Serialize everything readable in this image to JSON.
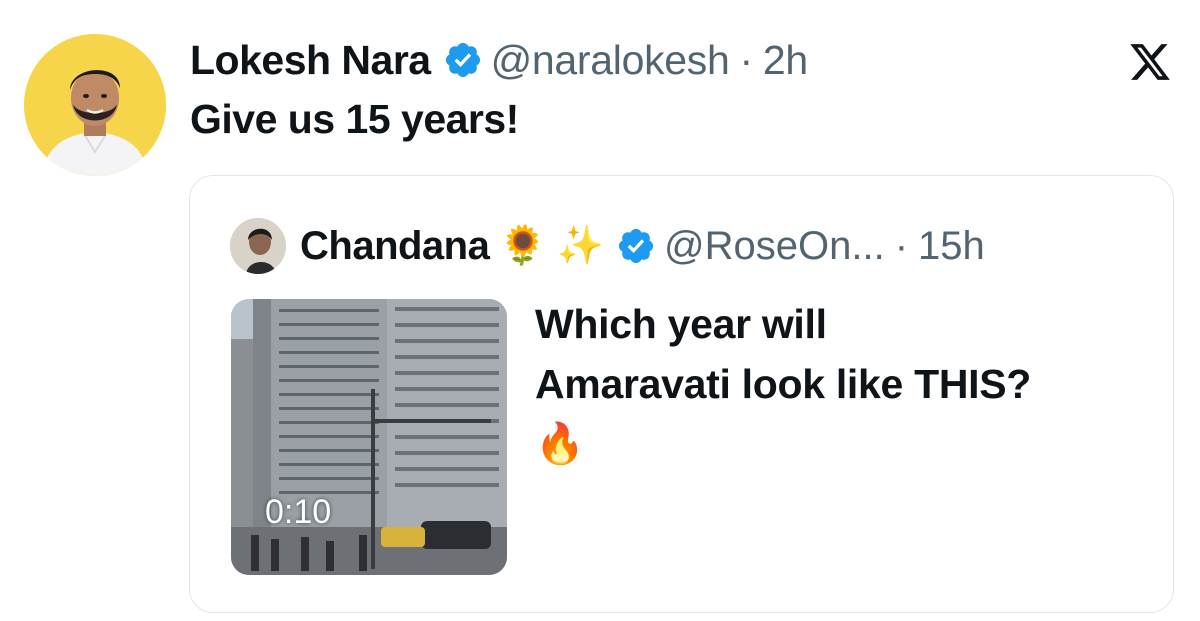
{
  "tweet": {
    "author_name": "Lokesh Nara",
    "handle": "@naralokesh",
    "separator": "·",
    "time": "2h",
    "text": "Give us 15 years!"
  },
  "quoted": {
    "author_name": "Chandana",
    "emojis": [
      "🌻",
      "✨"
    ],
    "handle": "@RoseOn...",
    "separator": "·",
    "time": "15h",
    "text_lines": [
      "Which year will",
      "Amaravati look like THIS?"
    ],
    "emoji_line": "🔥",
    "video_duration": "0:10"
  },
  "icons": {
    "verified": "verified-badge-icon",
    "brand": "x-logo-icon"
  },
  "colors": {
    "verified": "#1d9bf0",
    "secondary_text": "#536471",
    "avatar_bg": "#f7d54a",
    "card_border": "#e1e6ea"
  }
}
